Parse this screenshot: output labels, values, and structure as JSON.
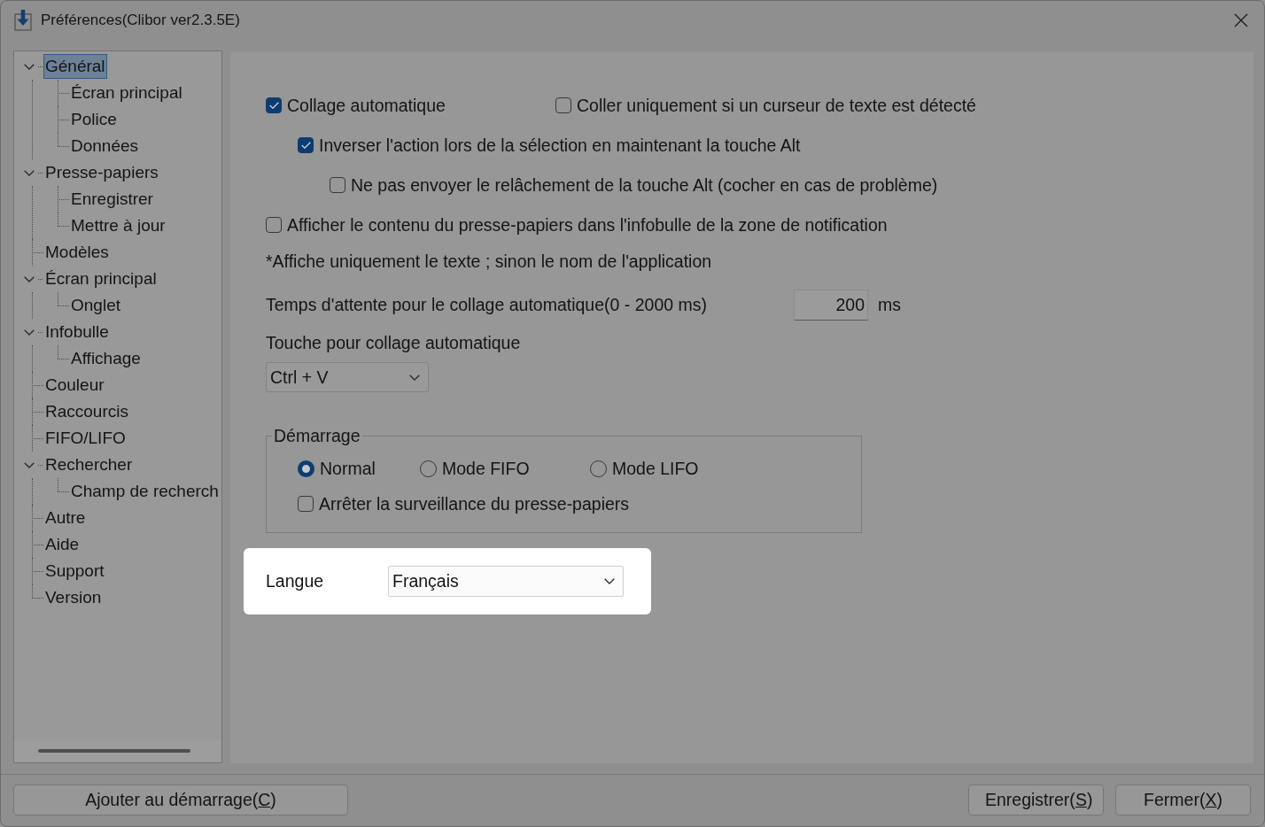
{
  "window": {
    "title": "Préférences(Clibor ver2.3.5E)"
  },
  "sidebar": {
    "tree": [
      {
        "label": "Général",
        "selected": true,
        "expanded": true,
        "children": [
          {
            "label": "Écran principal",
            "selected": false
          },
          {
            "label": "Police",
            "selected": false
          },
          {
            "label": "Données",
            "selected": false
          }
        ]
      },
      {
        "label": "Presse-papiers",
        "selected": false,
        "expanded": true,
        "children": [
          {
            "label": "Enregistrer",
            "selected": false
          },
          {
            "label": "Mettre à jour",
            "selected": false
          }
        ]
      },
      {
        "label": "Modèles",
        "selected": false
      },
      {
        "label": "Écran principal",
        "selected": false,
        "expanded": true,
        "children": [
          {
            "label": "Onglet",
            "selected": false
          }
        ]
      },
      {
        "label": "Infobulle",
        "selected": false,
        "expanded": true,
        "children": [
          {
            "label": "Affichage",
            "selected": false
          }
        ]
      },
      {
        "label": "Couleur",
        "selected": false
      },
      {
        "label": "Raccourcis",
        "selected": false
      },
      {
        "label": "FIFO/LIFO",
        "selected": false
      },
      {
        "label": "Rechercher",
        "selected": false,
        "expanded": true,
        "children": [
          {
            "label": "Champ de recherch",
            "selected": false
          }
        ]
      },
      {
        "label": "Autre",
        "selected": false
      },
      {
        "label": "Aide",
        "selected": false
      },
      {
        "label": "Support",
        "selected": false
      },
      {
        "label": "Version",
        "selected": false
      }
    ]
  },
  "general": {
    "auto_paste": {
      "label": "Collage automatique",
      "checked": true,
      "children": [
        {
          "label": "Inverser l'action lors de la sélection en maintenant la touche Alt",
          "checked": true,
          "children": [
            {
              "label": "Ne pas envoyer le relâchement de la touche Alt (cocher en cas de problème)",
              "checked": false
            }
          ]
        }
      ]
    },
    "cursor_only": {
      "label": "Coller uniquement si un curseur de texte est détecté",
      "checked": false
    },
    "tooltip_option": {
      "label": "Afficher le contenu du presse-papiers dans l'infobulle de la zone de notification",
      "checked": false
    },
    "note": "*Affiche uniquement le texte ; sinon le nom de l'application",
    "paste_delay": {
      "label": "Temps d'attente pour le collage automatique(0 - 2000 ms)",
      "value": "200",
      "unit": "ms"
    },
    "paste_key": {
      "label": "Touche pour collage automatique",
      "value": "Ctrl + V"
    },
    "startup": {
      "title": "Démarrage",
      "modes": [
        {
          "label": "Normal",
          "selected": true
        },
        {
          "label": "Mode FIFO",
          "selected": false
        },
        {
          "label": "Mode LIFO",
          "selected": false
        }
      ],
      "options": [
        {
          "label": "Arrêter la surveillance du presse-papiers",
          "checked": false
        }
      ]
    },
    "language": {
      "label": "Langue",
      "value": "Français",
      "highlighted": true
    }
  },
  "buttons": {
    "left": [
      {
        "before": "Ajouter au démarrage(",
        "access_key": "C",
        "after": ")"
      }
    ],
    "right": [
      {
        "before": "Enregistrer(",
        "access_key": "S",
        "after": ")"
      },
      {
        "before": "Fermer(",
        "access_key": "X",
        "after": ")"
      }
    ]
  }
}
